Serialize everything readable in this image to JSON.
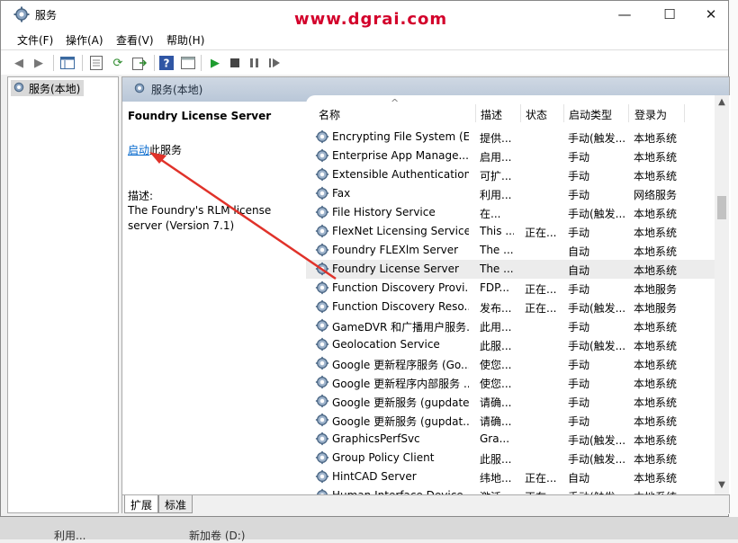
{
  "window": {
    "title": "服务",
    "watermark": "www.dgrai.com"
  },
  "titlebar_buttons": {
    "minimize": "—",
    "maximize": "☐",
    "close": "✕"
  },
  "menu": [
    "文件(F)",
    "操作(A)",
    "查看(V)",
    "帮助(H)"
  ],
  "tree": {
    "item": "服务(本地)"
  },
  "pane_header": "服务(本地)",
  "details": {
    "service_name": "Foundry License Server",
    "start_link": "启动",
    "start_suffix": "此服务",
    "desc_label": "描述:",
    "description": "The Foundry's RLM license server (Version 7.1)"
  },
  "columns": [
    "名称",
    "描述",
    "状态",
    "启动类型",
    "登录为"
  ],
  "rows": [
    {
      "name": "Encrypting File System (E...",
      "desc": "提供...",
      "status": "",
      "type": "手动(触发...",
      "logon": "本地系统"
    },
    {
      "name": "Enterprise App Manage...",
      "desc": "启用...",
      "status": "",
      "type": "手动",
      "logon": "本地系统"
    },
    {
      "name": "Extensible Authentication...",
      "desc": "可扩...",
      "status": "",
      "type": "手动",
      "logon": "本地系统"
    },
    {
      "name": "Fax",
      "desc": "利用...",
      "status": "",
      "type": "手动",
      "logon": "网络服务"
    },
    {
      "name": "File History Service",
      "desc": "在...",
      "status": "",
      "type": "手动(触发...",
      "logon": "本地系统"
    },
    {
      "name": "FlexNet Licensing Service...",
      "desc": "This ...",
      "status": "正在...",
      "type": "手动",
      "logon": "本地系统"
    },
    {
      "name": "Foundry FLEXlm Server",
      "desc": "The ...",
      "status": "",
      "type": "自动",
      "logon": "本地系统"
    },
    {
      "name": "Foundry License Server",
      "desc": "The ...",
      "status": "",
      "type": "自动",
      "logon": "本地系统",
      "selected": true
    },
    {
      "name": "Function Discovery Provi...",
      "desc": "FDP...",
      "status": "正在...",
      "type": "手动",
      "logon": "本地服务"
    },
    {
      "name": "Function Discovery Reso...",
      "desc": "发布...",
      "status": "正在...",
      "type": "手动(触发...",
      "logon": "本地服务"
    },
    {
      "name": "GameDVR 和广播用户服务...",
      "desc": "此用...",
      "status": "",
      "type": "手动",
      "logon": "本地系统"
    },
    {
      "name": "Geolocation Service",
      "desc": "此服...",
      "status": "",
      "type": "手动(触发...",
      "logon": "本地系统"
    },
    {
      "name": "Google 更新程序服务 (Go...",
      "desc": "使您...",
      "status": "",
      "type": "手动",
      "logon": "本地系统"
    },
    {
      "name": "Google 更新程序内部服务 ...",
      "desc": "使您...",
      "status": "",
      "type": "手动",
      "logon": "本地系统"
    },
    {
      "name": "Google 更新服务 (gupdate)",
      "desc": "请确...",
      "status": "",
      "type": "手动",
      "logon": "本地系统"
    },
    {
      "name": "Google 更新服务 (gupdat...",
      "desc": "请确...",
      "status": "",
      "type": "手动",
      "logon": "本地系统"
    },
    {
      "name": "GraphicsPerfSvc",
      "desc": "Gra...",
      "status": "",
      "type": "手动(触发...",
      "logon": "本地系统"
    },
    {
      "name": "Group Policy Client",
      "desc": "此服...",
      "status": "",
      "type": "手动(触发...",
      "logon": "本地系统"
    },
    {
      "name": "HintCAD Server",
      "desc": "纬地...",
      "status": "正在...",
      "type": "自动",
      "logon": "本地系统"
    },
    {
      "name": "Human Interface Device ...",
      "desc": "激活...",
      "status": "正在...",
      "type": "手动(触发...",
      "logon": "本地系统"
    }
  ],
  "tabs": [
    "扩展",
    "标准"
  ],
  "bottom_strip": [
    "利用...",
    "新加卷 (D:)"
  ]
}
